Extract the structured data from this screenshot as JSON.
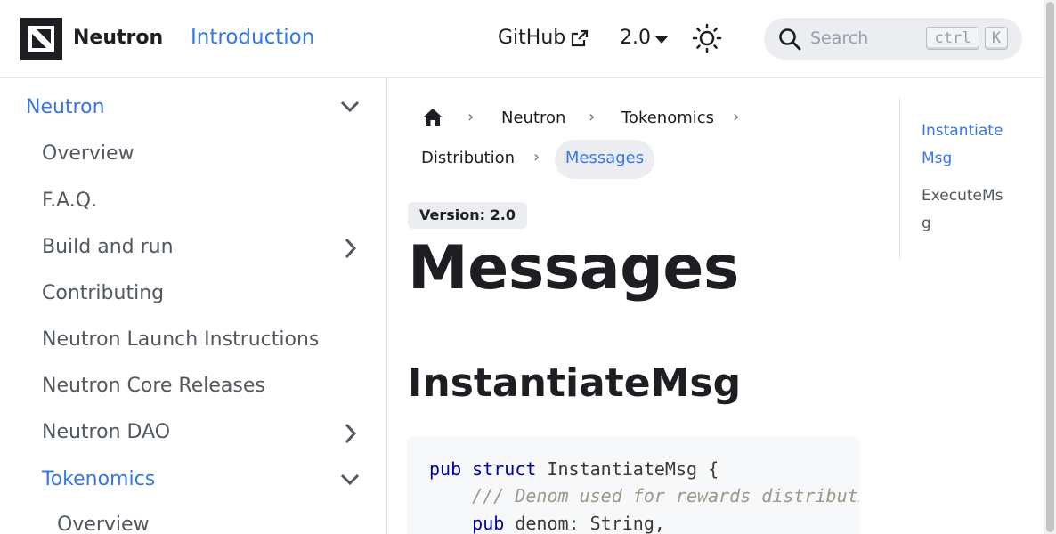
{
  "navbar": {
    "brand": "Neutron",
    "intro_link": "Introduction",
    "github_link": "GitHub",
    "version": "2.0",
    "search": {
      "placeholder": "Search",
      "kbd_ctrl": "ctrl",
      "kbd_k": "K"
    }
  },
  "sidebar": {
    "items": [
      {
        "label": "Neutron",
        "active": true,
        "toggle": "chevron-down"
      },
      {
        "label": "Overview"
      },
      {
        "label": "F.A.Q."
      },
      {
        "label": "Build and run",
        "toggle": "chevron-right"
      },
      {
        "label": "Contributing"
      },
      {
        "label": "Neutron Launch Instructions"
      },
      {
        "label": "Neutron Core Releases"
      },
      {
        "label": "Neutron DAO",
        "toggle": "chevron-right"
      },
      {
        "label": "Tokenomics",
        "active": true,
        "toggle": "chevron-down"
      },
      {
        "label": "Overview"
      }
    ]
  },
  "breadcrumbs": {
    "home_icon": "home-icon",
    "items": [
      "Neutron",
      "Tokenomics",
      "Distribution",
      "Messages"
    ]
  },
  "main": {
    "version_badge": "Version: 2.0",
    "title": "Messages",
    "section_title": "InstantiateMsg",
    "code": {
      "line1_kw1": "pub",
      "line1_kw2": "struct",
      "line1_rest": " InstantiateMsg {",
      "line2_comment": "/// Denom used for rewards distribution",
      "line3_kw": "pub",
      "line3_rest": " denom: String,"
    }
  },
  "toc": {
    "items": [
      "InstantiateMsg",
      "ExecuteMsg"
    ]
  },
  "colors": {
    "accent": "#3578e5",
    "text": "#1c1e21",
    "muted": "#525860",
    "pill_bg": "#ebedf0"
  }
}
